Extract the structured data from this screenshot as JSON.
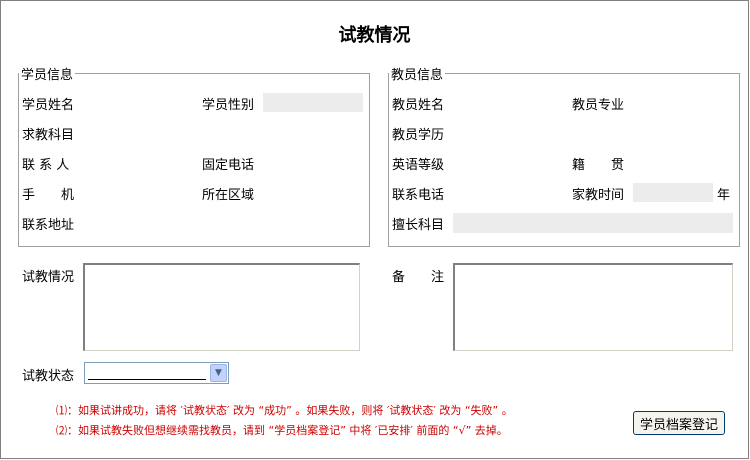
{
  "title": "试教情况",
  "student_info": {
    "legend": "学员信息",
    "name_label": "学员姓名",
    "gender_label": "学员性别",
    "subject_label": "求教科目",
    "contact_label": "联 系 人",
    "phone_label": "固定电话",
    "mobile_label": "手　　机",
    "area_label": "所在区域",
    "address_label": "联系地址"
  },
  "teacher_info": {
    "legend": "教员信息",
    "name_label": "教员姓名",
    "major_label": "教员专业",
    "education_label": "教员学历",
    "english_label": "英语等级",
    "hometown_label": "籍　　贯",
    "phone_label": "联系电话",
    "tutoring_time_label": "家教时间",
    "year_suffix": "年",
    "specialty_label": "擅长科目"
  },
  "trial_label": "试教情况",
  "remarks_label": "备　　注",
  "status_label": "试教状态",
  "status_value": "",
  "notes": [
    "⑴：如果试讲成功，请将 ′试教状态′ 改为 “成功” 。如果失败，则将 ′试教状态′ 改为 “失败” 。",
    "⑵：如果试教失败但想继续需找教员，请到 “学员档案登记” 中将 ′已安排′ 前面的 “√” 去掉。"
  ],
  "register_button": "学员档案登记",
  "colors": {
    "note_text": "#cc0000",
    "readonly_field": "#ececec",
    "border": "#a0a0a0"
  }
}
